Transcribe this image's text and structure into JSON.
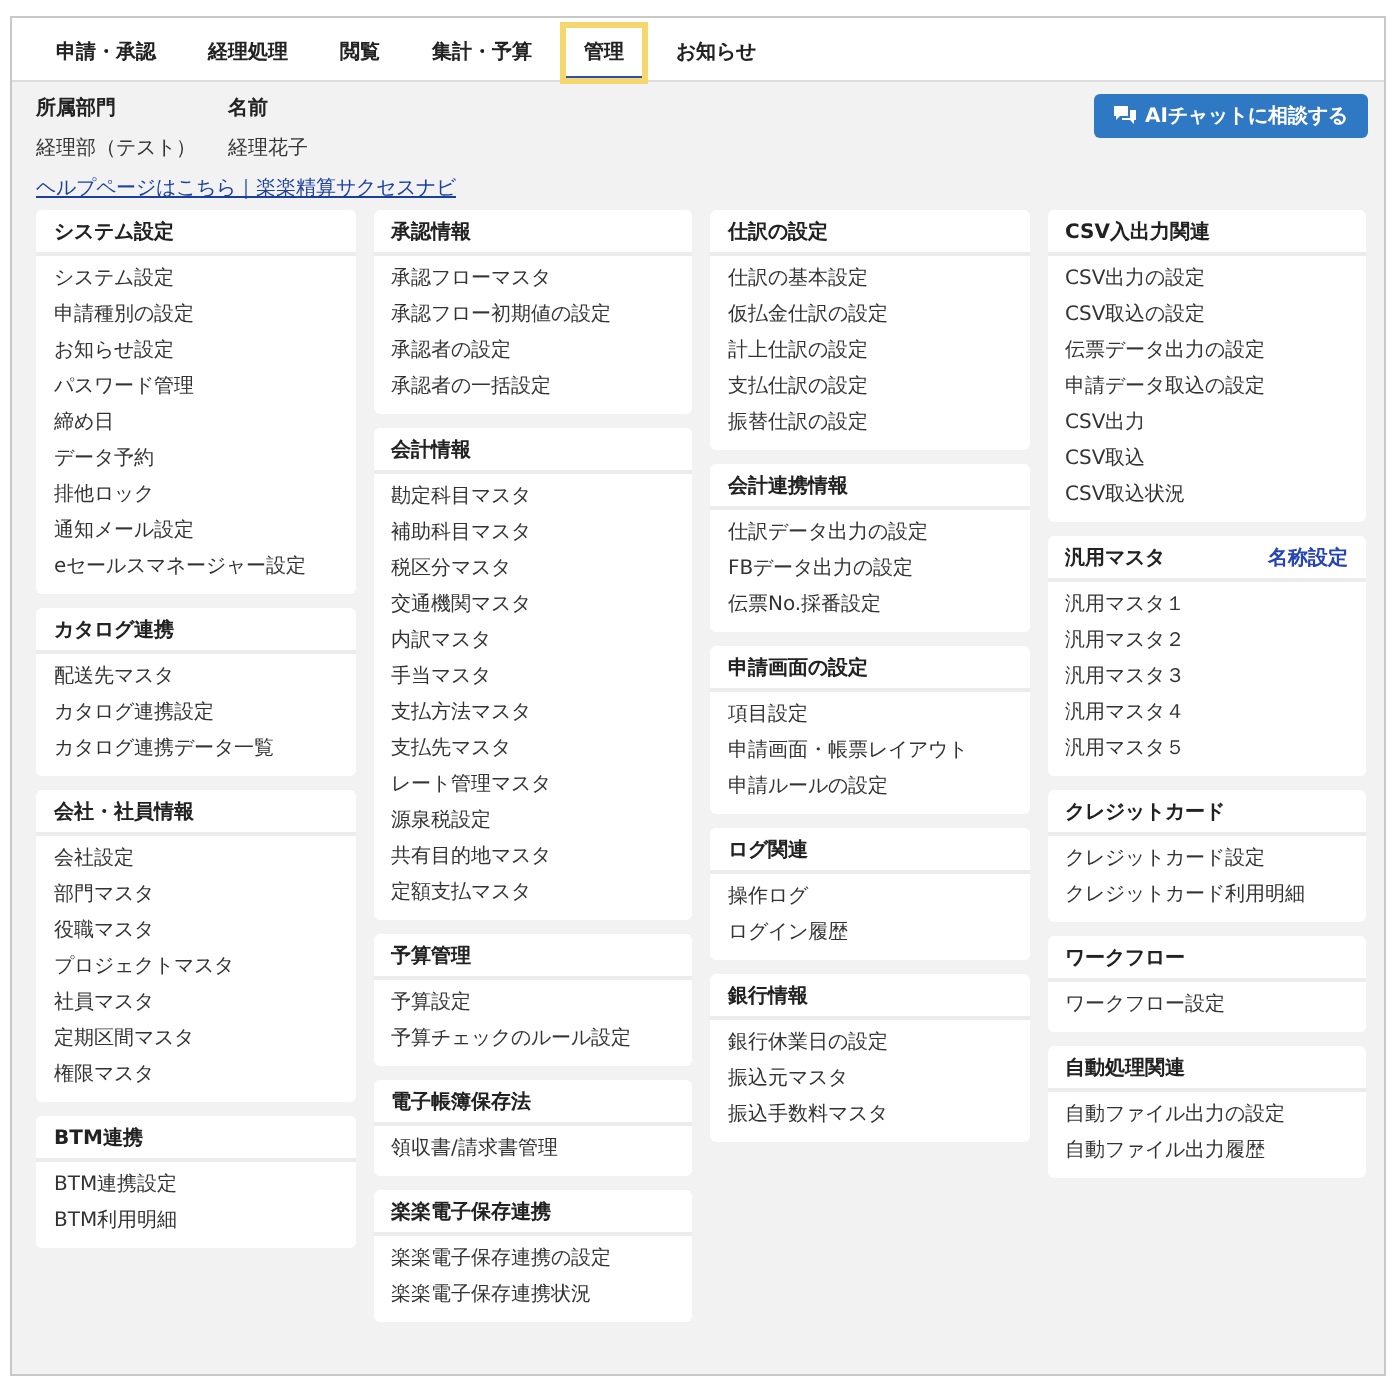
{
  "tabs": [
    {
      "label": "申請・承認",
      "selected": false
    },
    {
      "label": "経理処理",
      "selected": false
    },
    {
      "label": "閲覧",
      "selected": false
    },
    {
      "label": "集計・予算",
      "selected": false
    },
    {
      "label": "管理",
      "selected": true
    },
    {
      "label": "お知らせ",
      "selected": false
    }
  ],
  "user": {
    "department_label": "所属部門",
    "name_label": "名前",
    "department": "経理部（テスト）",
    "name": "経理花子"
  },
  "ai_button": "AIチャットに相談する",
  "help_link": "ヘルプページはこちら｜楽楽精算サクセスナビ",
  "columns": [
    [
      {
        "title": "システム設定",
        "items": [
          "システム設定",
          "申請種別の設定",
          "お知らせ設定",
          "パスワード管理",
          "締め日",
          "データ予約",
          "排他ロック",
          "通知メール設定",
          "eセールスマネージャー設定"
        ]
      },
      {
        "title": "カタログ連携",
        "items": [
          "配送先マスタ",
          "カタログ連携設定",
          "カタログ連携データ一覧"
        ]
      },
      {
        "title": "会社・社員情報",
        "items": [
          "会社設定",
          "部門マスタ",
          "役職マスタ",
          "プロジェクトマスタ",
          "社員マスタ",
          "定期区間マスタ",
          "権限マスタ"
        ]
      },
      {
        "title": "BTM連携",
        "items": [
          "BTM連携設定",
          "BTM利用明細"
        ]
      }
    ],
    [
      {
        "title": "承認情報",
        "items": [
          "承認フローマスタ",
          "承認フロー初期値の設定",
          "承認者の設定",
          "承認者の一括設定"
        ]
      },
      {
        "title": "会計情報",
        "items": [
          "勘定科目マスタ",
          "補助科目マスタ",
          "税区分マスタ",
          "交通機関マスタ",
          "内訳マスタ",
          "手当マスタ",
          "支払方法マスタ",
          "支払先マスタ",
          "レート管理マスタ",
          "源泉税設定",
          "共有目的地マスタ",
          "定額支払マスタ"
        ]
      },
      {
        "title": "予算管理",
        "items": [
          "予算設定",
          "予算チェックのルール設定"
        ]
      },
      {
        "title": "電子帳簿保存法",
        "items": [
          "領収書/請求書管理"
        ]
      },
      {
        "title": "楽楽電子保存連携",
        "items": [
          "楽楽電子保存連携の設定",
          "楽楽電子保存連携状況"
        ]
      }
    ],
    [
      {
        "title": "仕訳の設定",
        "items": [
          "仕訳の基本設定",
          "仮払金仕訳の設定",
          "計上仕訳の設定",
          "支払仕訳の設定",
          "振替仕訳の設定"
        ]
      },
      {
        "title": "会計連携情報",
        "items": [
          "仕訳データ出力の設定",
          "FBデータ出力の設定",
          "伝票No.採番設定"
        ]
      },
      {
        "title": "申請画面の設定",
        "items": [
          "項目設定",
          "申請画面・帳票レイアウト",
          "申請ルールの設定"
        ]
      },
      {
        "title": "ログ関連",
        "items": [
          "操作ログ",
          "ログイン履歴"
        ]
      },
      {
        "title": "銀行情報",
        "items": [
          "銀行休業日の設定",
          "振込元マスタ",
          "振込手数料マスタ"
        ]
      }
    ],
    [
      {
        "title": "CSV入出力関連",
        "items": [
          "CSV出力の設定",
          "CSV取込の設定",
          "伝票データ出力の設定",
          "申請データ取込の設定",
          "CSV出力",
          "CSV取込",
          "CSV取込状況"
        ]
      },
      {
        "title": "汎用マスタ",
        "link": "名称設定",
        "items": [
          "汎用マスタ１",
          "汎用マスタ２",
          "汎用マスタ３",
          "汎用マスタ４",
          "汎用マスタ５"
        ]
      },
      {
        "title": "クレジットカード",
        "items": [
          "クレジットカード設定",
          "クレジットカード利用明細"
        ]
      },
      {
        "title": "ワークフロー",
        "items": [
          "ワークフロー設定"
        ]
      },
      {
        "title": "自動処理関連",
        "items": [
          "自動ファイル出力の設定",
          "自動ファイル出力履歴"
        ]
      }
    ]
  ]
}
